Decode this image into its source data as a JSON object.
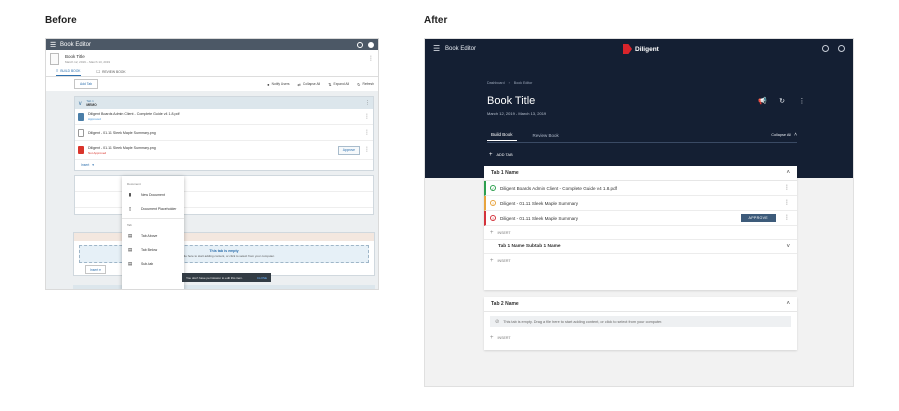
{
  "headings": {
    "before": "Before",
    "after": "After"
  },
  "before": {
    "app_title": "Book Editor",
    "book_title": "Book Title",
    "book_dates": "March 12, 2019  –  March 13, 2019",
    "tabs": [
      {
        "label": "BUILD BOOK",
        "glyph": "≡"
      },
      {
        "label": "REVIEW BOOK",
        "glyph": "☐"
      }
    ],
    "toolbar": {
      "add_tab": "Add Tab",
      "notify_users": "Notify Users",
      "collapse_all": "Collapse All",
      "expand_all": "Expand All",
      "refresh": "Refresh"
    },
    "tab1": {
      "label": "Tab 1",
      "name": "MEMO",
      "docs": [
        {
          "name": "Diligent Boards Admin Client - Complete Guide v4 1.8.pdf",
          "status": "Approved"
        },
        {
          "name": "Diligent - 01.11 Sleek Maple Summary.png",
          "status": ""
        },
        {
          "name": "Diligent - 01.11 Sleek Maple Summary.png",
          "status": "Not Approved"
        }
      ],
      "approve_label": "Approve",
      "insert_label": "Insert"
    },
    "insert_menu": {
      "section_document": "Document",
      "items_document": [
        "New Document",
        "Document Placeholder"
      ],
      "section_tab": "Tab",
      "items_tab": [
        "Tab Above",
        "Tab Below",
        "Sub-tab"
      ]
    },
    "empty": {
      "title": "This tab is empty",
      "subtitle": "Drag a file here to start adding content, or click to select from your computer.",
      "insert_label": "Insert"
    },
    "toast": {
      "message": "You don't have permission to edit this item.",
      "action": "CLOSE"
    }
  },
  "after": {
    "app_title": "Book Editor",
    "logo_text": "Diligent",
    "breadcrumb": [
      "Dashboard",
      "Book Editor"
    ],
    "book_title": "Book Title",
    "book_dates": "March 12, 2019 - March 13, 2019",
    "tabs": [
      "Build Book",
      "Review Book"
    ],
    "collapse_all": "Collapse All",
    "add_tab": "ADD TAB",
    "tab1": {
      "name": "Tab 1 Name",
      "docs": [
        {
          "name": "Diligent Boards Admin Client - Complete Guide v4 1.8.pdf",
          "status": "approved"
        },
        {
          "name": "Diligent - 01.11 Sleek Maple Summary",
          "status": "pending"
        },
        {
          "name": "Diligent - 01.11 Sleek Maple Summary",
          "status": "not-approved"
        }
      ],
      "approve_label": "APPROVE",
      "insert_label": "INSERT",
      "subtab_name": "Tab 1 Name Subtab 1 Name",
      "subtab_insert_label": "INSERT"
    },
    "tab2": {
      "name": "Tab 2 Name",
      "empty_message": "This tab is empty. Drag a file here to start adding content, or click to select from your computer.",
      "insert_label": "INSERT"
    }
  },
  "colors": {
    "after_header": "#141f33",
    "approved": "#2e9f4f",
    "pending": "#e8a33d",
    "not_approved": "#d4333b",
    "approve_button": "#3d5b7a",
    "before_topbar": "#4c5866",
    "logo": "#d9242b"
  },
  "icons": [
    "hamburger-menu-icon",
    "help-icon",
    "user-icon",
    "kebab-icon",
    "chevron-down-icon",
    "chevron-up-icon",
    "chevron-right-icon",
    "megaphone-icon",
    "refresh-icon",
    "plus-icon",
    "check-circle-icon",
    "warning-circle-icon",
    "error-circle-icon",
    "empty-icon"
  ]
}
